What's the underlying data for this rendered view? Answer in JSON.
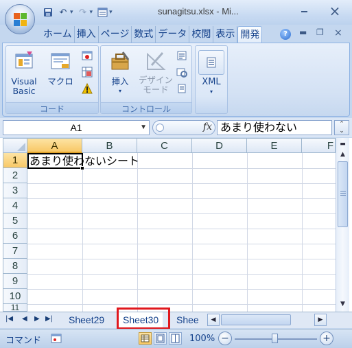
{
  "window": {
    "title": "sunagitsu.xlsx - Mi...",
    "min_icon": "minimize-icon",
    "close_glyph": "×"
  },
  "ribbon_tabs": [
    "ホーム",
    "挿入",
    "ページ",
    "数式",
    "データ",
    "校閲",
    "表示",
    "開発"
  ],
  "active_tab": "開発",
  "ribbon": {
    "code_group": {
      "label": "コード",
      "visual_basic": "Visual\nBasic",
      "macro": "マクロ"
    },
    "controls_group": {
      "label": "コントロール",
      "insert": "挿入",
      "design_mode": "デザイン\nモード"
    },
    "xml_group": {
      "xml": "XML"
    }
  },
  "formula_bar": {
    "name_box": "A1",
    "fx": "fx",
    "value": "あまり使わない"
  },
  "grid": {
    "columns": [
      "A",
      "B",
      "C",
      "D",
      "E",
      "F"
    ],
    "rows": [
      "1",
      "2",
      "3",
      "4",
      "5",
      "6",
      "7",
      "8",
      "9",
      "10",
      "11"
    ],
    "active_cell": "A1",
    "cell_a1": "あまり使わないシート"
  },
  "sheets": {
    "tabs": [
      "Sheet29",
      "Sheet30",
      "Shee"
    ],
    "active": "Sheet30"
  },
  "status": {
    "mode": "コマンド",
    "zoom": "100%",
    "zoom_out": "−",
    "zoom_in": "+"
  },
  "colors": {
    "accent": "#15428b",
    "highlight": "#e0181e",
    "selected_header": "#f8c866"
  }
}
